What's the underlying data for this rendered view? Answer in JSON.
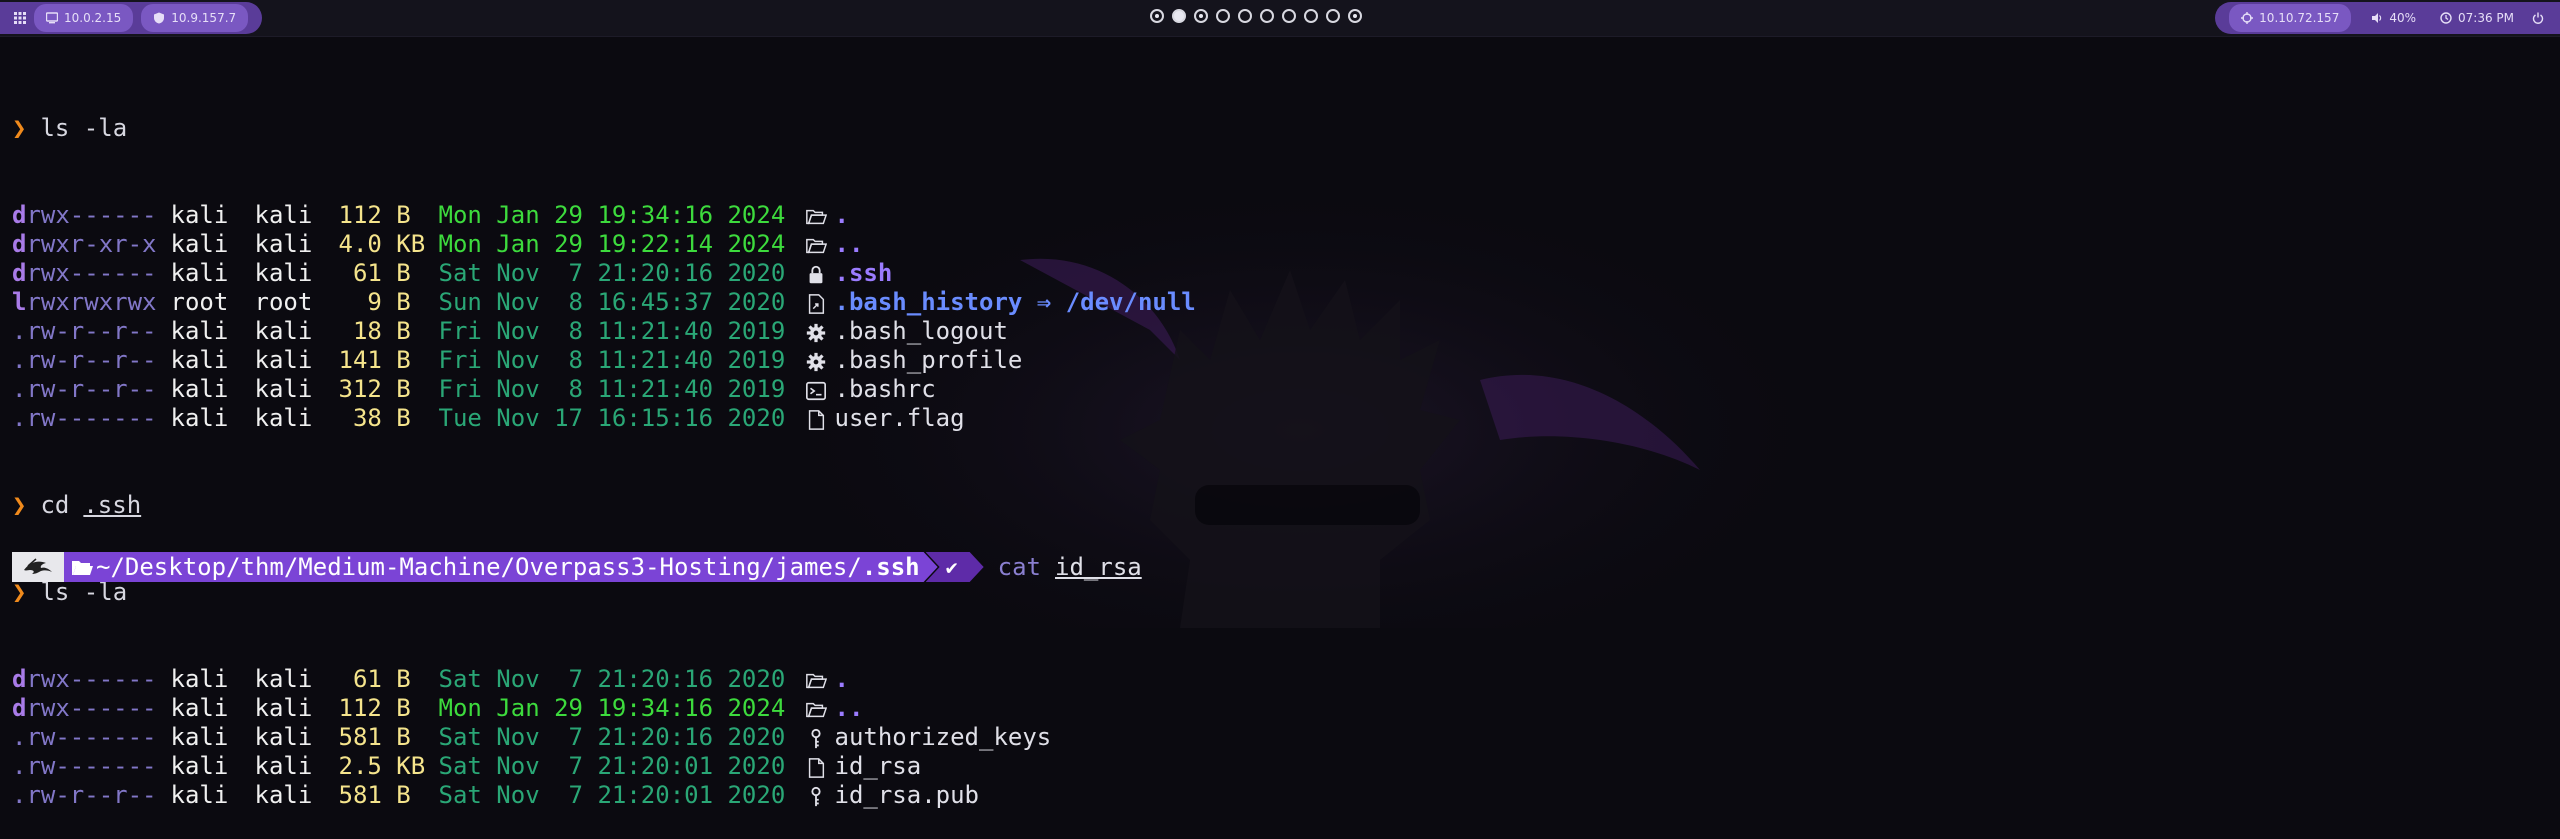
{
  "topbar": {
    "ips_left": [
      {
        "icon": "monitor-icon",
        "text": "10.0.2.15"
      },
      {
        "icon": "shield-icon",
        "text": "10.9.157.7"
      }
    ],
    "workspaces": [
      {
        "state": "ring"
      },
      {
        "state": "filled"
      },
      {
        "state": "ring"
      },
      {
        "state": "empty"
      },
      {
        "state": "empty"
      },
      {
        "state": "empty"
      },
      {
        "state": "empty"
      },
      {
        "state": "empty"
      },
      {
        "state": "empty"
      },
      {
        "state": "ring"
      }
    ],
    "right": {
      "target_ip": "10.10.72.157",
      "volume": "40%",
      "time": "07:36 PM"
    }
  },
  "terminal": {
    "cmd1": "ls -la",
    "listing1": [
      {
        "t": "d",
        "perm": "rwx------",
        "owner": "kali",
        "group": "kali",
        "size": "112 B",
        "date": "Mon Jan 29 19:34:16 2024",
        "recent": true,
        "icon": "folder-open-icon",
        "name": ".",
        "kind": "dir"
      },
      {
        "t": "d",
        "perm": "rwxr-xr-x",
        "owner": "kali",
        "group": "kali",
        "size": "4.0 KB",
        "date": "Mon Jan 29 19:22:14 2024",
        "recent": true,
        "icon": "folder-open-icon",
        "name": "..",
        "kind": "dir"
      },
      {
        "t": "d",
        "perm": "rwx------",
        "owner": "kali",
        "group": "kali",
        "size": " 61 B",
        "date": "Sat Nov  7 21:20:16 2020",
        "recent": false,
        "icon": "lock-icon",
        "name": ".ssh",
        "kind": "dir"
      },
      {
        "t": "l",
        "perm": "rwxrwxrwx",
        "owner": "root",
        "group": "root",
        "size": "  9 B",
        "date": "Sun Nov  8 16:45:37 2020",
        "recent": false,
        "icon": "file-link-icon",
        "name": ".bash_history",
        "kind": "link",
        "target": "/dev/null"
      },
      {
        "t": ".",
        "perm": "rw-r--r--",
        "owner": "kali",
        "group": "kali",
        "size": " 18 B",
        "date": "Fri Nov  8 11:21:40 2019",
        "recent": false,
        "icon": "gear-icon",
        "name": ".bash_logout",
        "kind": "file"
      },
      {
        "t": ".",
        "perm": "rw-r--r--",
        "owner": "kali",
        "group": "kali",
        "size": "141 B",
        "date": "Fri Nov  8 11:21:40 2019",
        "recent": false,
        "icon": "gear-icon",
        "name": ".bash_profile",
        "kind": "file"
      },
      {
        "t": ".",
        "perm": "rw-r--r--",
        "owner": "kali",
        "group": "kali",
        "size": "312 B",
        "date": "Fri Nov  8 11:21:40 2019",
        "recent": false,
        "icon": "terminal-icon",
        "name": ".bashrc",
        "kind": "file"
      },
      {
        "t": ".",
        "perm": "rw-------",
        "owner": "kali",
        "group": "kali",
        "size": " 38 B",
        "date": "Tue Nov 17 16:15:16 2020",
        "recent": false,
        "icon": "file-icon",
        "name": "user.flag",
        "kind": "file"
      }
    ],
    "cmd2_name": "cd",
    "cmd2_arg": ".ssh",
    "cmd3": "ls -la",
    "listing2": [
      {
        "t": "d",
        "perm": "rwx------",
        "owner": "kali",
        "group": "kali",
        "size": " 61 B",
        "date": "Sat Nov  7 21:20:16 2020",
        "recent": false,
        "icon": "folder-open-icon",
        "name": ".",
        "kind": "dir"
      },
      {
        "t": "d",
        "perm": "rwx------",
        "owner": "kali",
        "group": "kali",
        "size": "112 B",
        "date": "Mon Jan 29 19:34:16 2024",
        "recent": true,
        "icon": "folder-open-icon",
        "name": "..",
        "kind": "dir"
      },
      {
        "t": ".",
        "perm": "rw-------",
        "owner": "kali",
        "group": "kali",
        "size": "581 B",
        "date": "Sat Nov  7 21:20:16 2020",
        "recent": false,
        "icon": "key-icon",
        "name": "authorized_keys",
        "kind": "file"
      },
      {
        "t": ".",
        "perm": "rw-------",
        "owner": "kali",
        "group": "kali",
        "size": "2.5 KB",
        "date": "Sat Nov  7 21:20:01 2020",
        "recent": false,
        "icon": "file-icon",
        "name": "id_rsa",
        "kind": "file"
      },
      {
        "t": ".",
        "perm": "rw-r--r--",
        "owner": "kali",
        "group": "kali",
        "size": "581 B",
        "date": "Sat Nov  7 21:20:01 2020",
        "recent": false,
        "icon": "key-icon",
        "name": "id_rsa.pub",
        "kind": "file"
      }
    ],
    "prompt": {
      "path_prefix": "~/Desktop/thm/Medium-Machine/Overpass3-Hosting/james/",
      "path_last": ".ssh",
      "status": "✔",
      "cmd": "cat",
      "arg": "id_rsa"
    }
  },
  "colors": {
    "accent": "#7b44d6",
    "prompt_arrow": "#f08a1c",
    "recent_date": "#3ddb3d",
    "old_date": "#2aa776",
    "size": "#f5e48c"
  }
}
